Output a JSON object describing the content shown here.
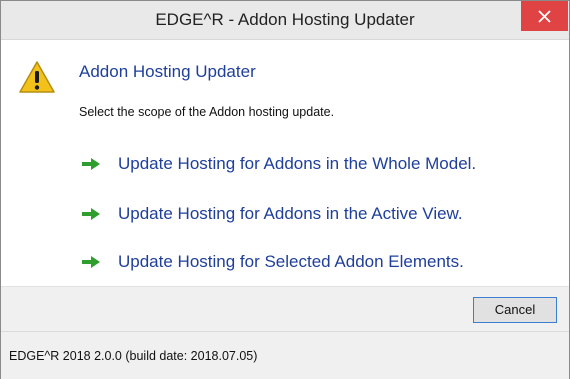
{
  "window": {
    "title": "EDGE^R - Addon Hosting Updater",
    "close_icon": "close-icon"
  },
  "dialog": {
    "icon": "warning-icon",
    "main_instruction": "Addon Hosting Updater",
    "content_text": "Select the scope of the Addon hosting update.",
    "command_links": [
      {
        "label": "Update Hosting for Addons in the Whole Model.",
        "icon": "green-arrow-icon"
      },
      {
        "label": "Update Hosting for Addons in the Active View.",
        "icon": "green-arrow-icon"
      },
      {
        "label": "Update Hosting for Selected Addon Elements.",
        "icon": "green-arrow-icon"
      }
    ]
  },
  "buttons": {
    "cancel_label": "Cancel"
  },
  "footer": {
    "text": "EDGE^R 2018 2.0.0 (build date: 2018.07.05)"
  },
  "colors": {
    "link_blue": "#1f3f9a",
    "close_red": "#e04343",
    "arrow_green": "#2e9e2e",
    "warning_yellow": "#f2c21b"
  }
}
